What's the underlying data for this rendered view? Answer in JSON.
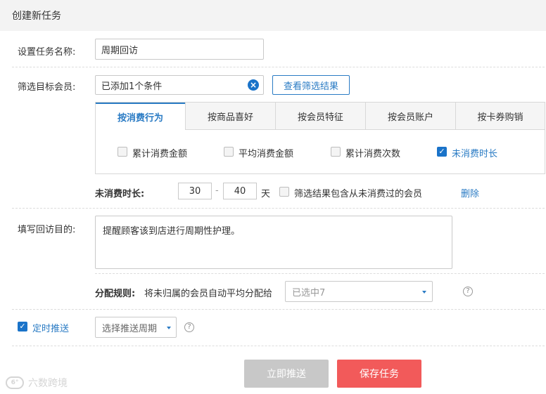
{
  "header": {
    "title": "创建新任务"
  },
  "task_name": {
    "label": "设置任务名称:",
    "value": "周期回访"
  },
  "filter": {
    "label": "筛选目标会员:",
    "value": "已添加1个条件",
    "view_button": "查看筛选结果"
  },
  "tabs": [
    {
      "label": "按消费行为",
      "active": true
    },
    {
      "label": "按商品喜好",
      "active": false
    },
    {
      "label": "按会员特征",
      "active": false
    },
    {
      "label": "按会员账户",
      "active": false
    },
    {
      "label": "按卡券购销",
      "active": false
    }
  ],
  "checkboxes": [
    {
      "label": "累计消费金额",
      "checked": false
    },
    {
      "label": "平均消费金额",
      "checked": false
    },
    {
      "label": "累计消费次数",
      "checked": false
    },
    {
      "label": "未消费时长",
      "checked": true
    }
  ],
  "duration": {
    "label": "未消费时长:",
    "from": "30",
    "sep": "-",
    "to": "40",
    "unit": "天",
    "include_label": "筛选结果包含从未消费过的会员",
    "include_checked": false,
    "delete_label": "删除"
  },
  "purpose": {
    "label": "填写回访目的:",
    "text": "提醒顾客该到店进行周期性护理。"
  },
  "assign": {
    "label": "分配规则:",
    "desc": "将未归属的会员自动平均分配给",
    "selected": "已选中7"
  },
  "schedule": {
    "label": "定时推送",
    "checked": true,
    "placeholder": "选择推送周期"
  },
  "buttons": {
    "push_now": "立即推送",
    "save": "保存任务"
  },
  "watermark": {
    "text": "六数跨境"
  },
  "colors": {
    "accent": "#2a7bc4",
    "save": "#f25a5a",
    "disabled": "#c8c8c8"
  }
}
